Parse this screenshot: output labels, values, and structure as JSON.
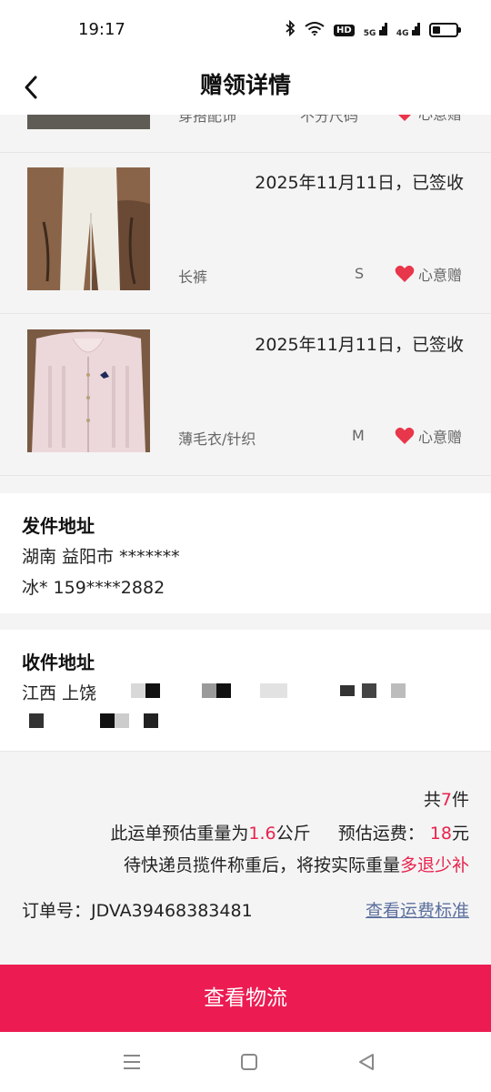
{
  "status_bar": {
    "time": "19:17",
    "hd": "HD",
    "net1": "5G",
    "net2": "4G"
  },
  "header": {
    "title": "赠领详情"
  },
  "items": [
    {
      "date": "",
      "name": "穿搭配饰",
      "size": "不分尺码",
      "tag": "心意赠"
    },
    {
      "date": "2025年11月11日，已签收",
      "name": "长裤",
      "size": "S",
      "tag": "心意赠"
    },
    {
      "date": "2025年11月11日，已签收",
      "name": "薄毛衣/针织",
      "size": "M",
      "tag": "心意赠"
    }
  ],
  "sender": {
    "title": "发件地址",
    "line1": "湖南 益阳市 *******",
    "line2": "冰* 159****2882"
  },
  "receiver": {
    "title": "收件地址",
    "line1": "江西 上饶",
    "line2": ""
  },
  "summary": {
    "total_prefix": "共",
    "total_count": "7",
    "total_suffix": "件",
    "weight_prefix": "此运单预估重量为",
    "weight_value": "1.6",
    "weight_unit": "公斤",
    "fee_prefix": "预估运费：",
    "fee_value": "18",
    "fee_unit": "元",
    "note_prefix": "待快递员揽件称重后，将按实际重量",
    "note_highlight": "多退少补",
    "order_label": "订单号：JDVA39468383481",
    "fee_link": "查看运费标准"
  },
  "bottom_button": {
    "label": "查看物流"
  },
  "colors": {
    "accent": "#ec1c53",
    "highlight": "#e8234e",
    "link": "#5b6f9e",
    "heart": "#e8364a"
  },
  "icons": [
    "back-arrow-icon",
    "heart-icon",
    "menu-icon",
    "home-square-icon",
    "back-triangle-icon"
  ]
}
